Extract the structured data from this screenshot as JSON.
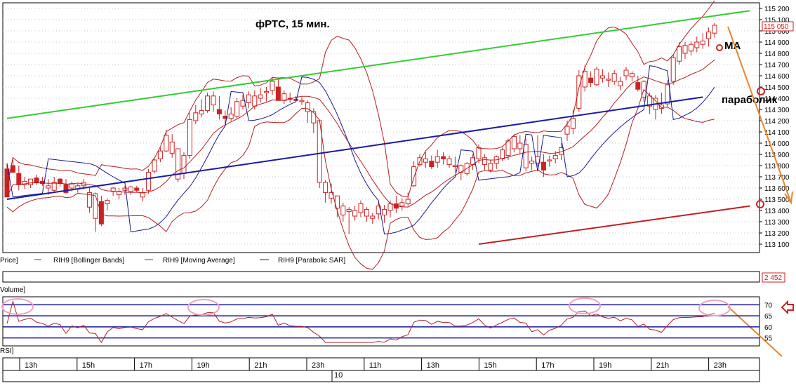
{
  "title": "фРТС,  15 мин.",
  "colors": {
    "up_candle": "#cc2222",
    "down_candle": "#cc2222",
    "bollinger": "#b22020",
    "moving_average": "#b22020",
    "parabolic_sar": "#1a1a8c",
    "green_trend": "#33cc33",
    "blue_trend": "#1a1aa0",
    "red_trend": "#c02020",
    "orange_arrow": "#e8882a",
    "rsi_line": "#b22020",
    "rsi_band": "#1a1aa0",
    "ellipse": "#f0a0c8",
    "last_price_box": "#cc2222"
  },
  "price_axis": {
    "ticks": [
      "115 200",
      "115 100",
      "115 000",
      "114 900",
      "114 800",
      "114 700",
      "114 600",
      "114 500",
      "114 400",
      "114 300",
      "114 200",
      "114 100",
      "114 000",
      "113 900",
      "113 800",
      "113 700",
      "113 600",
      "113 500",
      "113 400",
      "113 300",
      "113 200",
      "113 100"
    ],
    "last_price": "115 050"
  },
  "legend": {
    "price": "Price]",
    "bollinger": "RIH9 [Bollinger Bands]",
    "ma": "RIH9 [Moving Average]",
    "sar": "RIH9 [Parabolic SAR]"
  },
  "annotations": {
    "ma": "MA",
    "parabolic": "параболик"
  },
  "volume": {
    "label": "Volume]",
    "value": "2 452"
  },
  "rsi": {
    "label": "RSI]",
    "ticks": [
      "70",
      "65",
      "60",
      "55"
    ],
    "levels": [
      70,
      65,
      60,
      55
    ]
  },
  "time_axis": {
    "hours": [
      "13h",
      "15h",
      "17h",
      "19h",
      "21h",
      "23h",
      "11h",
      "13h",
      "15h",
      "17h",
      "19h",
      "21h",
      "23h"
    ],
    "day": "10"
  },
  "chart_data": {
    "type": "candlestick",
    "title": "фРТС,  15 мин.",
    "instrument": "RIH9",
    "ylim": [
      113050,
      115230
    ],
    "candles": [
      [
        113770,
        113820,
        113520,
        113520
      ],
      [
        113800,
        113860,
        113740,
        113740
      ],
      [
        113730,
        113800,
        113580,
        113630
      ],
      [
        113630,
        113700,
        113590,
        113660
      ],
      [
        113630,
        113680,
        113600,
        113680
      ],
      [
        113690,
        113720,
        113630,
        113650
      ],
      [
        113660,
        113700,
        113620,
        113640
      ],
      [
        113600,
        113680,
        113540,
        113620
      ],
      [
        113580,
        113700,
        113560,
        113650
      ],
      [
        113680,
        113690,
        113610,
        113640
      ],
      [
        113630,
        113680,
        113550,
        113560
      ],
      [
        113600,
        113660,
        113570,
        113640
      ],
      [
        113590,
        113640,
        113560,
        113620
      ],
      [
        113620,
        113680,
        113590,
        113650
      ],
      [
        113430,
        113600,
        113380,
        113560
      ],
      [
        113330,
        113560,
        113210,
        113550
      ],
      [
        113480,
        113530,
        113260,
        113280
      ],
      [
        113460,
        113510,
        113400,
        113490
      ],
      [
        113570,
        113610,
        113530,
        113600
      ],
      [
        113540,
        113600,
        113500,
        113570
      ],
      [
        113580,
        113620,
        113540,
        113600
      ],
      [
        113570,
        113620,
        113540,
        113610
      ],
      [
        113600,
        113620,
        113560,
        113580
      ],
      [
        113520,
        113600,
        113480,
        113560
      ],
      [
        113580,
        113770,
        113550,
        113740
      ],
      [
        113750,
        113860,
        113730,
        113850
      ],
      [
        113860,
        113960,
        113830,
        113930
      ],
      [
        113930,
        114120,
        113920,
        114070
      ],
      [
        113910,
        114080,
        113870,
        114010
      ],
      [
        113680,
        113950,
        113650,
        113950
      ],
      [
        113730,
        113920,
        113680,
        113890
      ],
      [
        113890,
        114270,
        113860,
        114210
      ],
      [
        114200,
        114340,
        114170,
        114270
      ],
      [
        114260,
        114390,
        114230,
        114290
      ],
      [
        114290,
        114450,
        114270,
        114420
      ],
      [
        114340,
        114460,
        114280,
        114420
      ],
      [
        114300,
        114420,
        114210,
        114260
      ],
      [
        114240,
        114290,
        114170,
        114220
      ],
      [
        114220,
        114320,
        114200,
        114260
      ],
      [
        114240,
        114400,
        114220,
        114370
      ],
      [
        114330,
        114430,
        114300,
        114380
      ],
      [
        114360,
        114460,
        114310,
        114430
      ],
      [
        114330,
        114470,
        114300,
        114420
      ],
      [
        114400,
        114490,
        114360,
        114430
      ],
      [
        114450,
        114500,
        114370,
        114460
      ],
      [
        114470,
        114590,
        114430,
        114550
      ],
      [
        114500,
        114570,
        114380,
        114380
      ],
      [
        114380,
        114470,
        114350,
        114440
      ],
      [
        114400,
        114450,
        114360,
        114390
      ],
      [
        114390,
        114420,
        114370,
        114380
      ],
      [
        114370,
        114410,
        114340,
        114380
      ],
      [
        114280,
        114380,
        114180,
        114360
      ],
      [
        114180,
        114310,
        114090,
        114280
      ],
      [
        113650,
        114210,
        113600,
        114200
      ],
      [
        113560,
        113670,
        113470,
        113650
      ],
      [
        113510,
        113640,
        113460,
        113560
      ],
      [
        113420,
        113530,
        113340,
        113530
      ],
      [
        113360,
        113470,
        113300,
        113440
      ],
      [
        113390,
        113430,
        113190,
        113410
      ],
      [
        113350,
        113440,
        113310,
        113400
      ],
      [
        113380,
        113490,
        113340,
        113460
      ],
      [
        113350,
        113430,
        113300,
        113410
      ],
      [
        113330,
        113380,
        113280,
        113350
      ],
      [
        113370,
        113480,
        113320,
        113440
      ],
      [
        113360,
        113450,
        113290,
        113410
      ],
      [
        113400,
        113490,
        113340,
        113460
      ],
      [
        113460,
        113530,
        113380,
        113420
      ],
      [
        113440,
        113510,
        113400,
        113470
      ],
      [
        113460,
        113560,
        113440,
        113500
      ],
      [
        113620,
        113840,
        113610,
        113790
      ],
      [
        113810,
        113900,
        113790,
        113870
      ],
      [
        113830,
        113920,
        113780,
        113860
      ],
      [
        113840,
        113890,
        113770,
        113790
      ],
      [
        113830,
        113940,
        113780,
        113880
      ],
      [
        113880,
        113920,
        113810,
        113860
      ],
      [
        113810,
        113890,
        113780,
        113860
      ],
      [
        113800,
        113880,
        113740,
        113800
      ],
      [
        113740,
        113810,
        113670,
        113800
      ],
      [
        113730,
        113830,
        113710,
        113820
      ],
      [
        113810,
        113900,
        113760,
        113870
      ],
      [
        113860,
        113990,
        113820,
        113960
      ],
      [
        113810,
        113900,
        113760,
        113870
      ],
      [
        113760,
        113850,
        113740,
        113820
      ],
      [
        113820,
        113890,
        113770,
        113880
      ],
      [
        113860,
        113960,
        113840,
        113940
      ],
      [
        113890,
        114040,
        113850,
        114020
      ],
      [
        113950,
        114080,
        113920,
        114060
      ],
      [
        113950,
        114070,
        113900,
        114000
      ],
      [
        113780,
        114040,
        113750,
        113990
      ],
      [
        113820,
        113880,
        113760,
        113840
      ],
      [
        113820,
        114070,
        113790,
        113880
      ],
      [
        113830,
        113900,
        113700,
        113760
      ],
      [
        113850,
        113890,
        113790,
        113850
      ],
      [
        113860,
        113930,
        113820,
        113890
      ],
      [
        113900,
        114000,
        113850,
        113960
      ],
      [
        114080,
        114200,
        114020,
        114150
      ],
      [
        114130,
        114300,
        114080,
        114220
      ],
      [
        114310,
        114650,
        114280,
        114600
      ],
      [
        114500,
        114690,
        114460,
        114640
      ],
      [
        114580,
        114640,
        114500,
        114540
      ],
      [
        114520,
        114680,
        114510,
        114660
      ],
      [
        114580,
        114660,
        114540,
        114600
      ],
      [
        114570,
        114630,
        114500,
        114570
      ],
      [
        114550,
        114650,
        114520,
        114620
      ],
      [
        114510,
        114590,
        114470,
        114550
      ],
      [
        114600,
        114680,
        114560,
        114650
      ],
      [
        114590,
        114640,
        114550,
        114620
      ],
      [
        114540,
        114600,
        114460,
        114480
      ],
      [
        114410,
        114560,
        114370,
        114550
      ],
      [
        114330,
        114450,
        114260,
        114420
      ],
      [
        114300,
        114430,
        114210,
        114400
      ],
      [
        114310,
        114450,
        114260,
        114340
      ],
      [
        114350,
        114560,
        114320,
        114520
      ],
      [
        114550,
        114790,
        114520,
        114760
      ],
      [
        114730,
        114900,
        114700,
        114860
      ],
      [
        114800,
        114900,
        114750,
        114870
      ],
      [
        114820,
        114910,
        114780,
        114880
      ],
      [
        114850,
        114950,
        114810,
        114900
      ],
      [
        114880,
        114980,
        114840,
        114910
      ],
      [
        114930,
        115030,
        114860,
        114990
      ],
      [
        114980,
        115070,
        114940,
        115050
      ]
    ],
    "trendlines": [
      {
        "color": "green",
        "from": [
          0,
          114220
        ],
        "to": [
          126,
          115180
        ]
      },
      {
        "color": "blue",
        "from": [
          0,
          113500
        ],
        "to": [
          118,
          114410
        ]
      },
      {
        "color": "red",
        "from": [
          80,
          113100
        ],
        "to": [
          126,
          113440
        ]
      }
    ],
    "rsi_levels": [
      70,
      65,
      60,
      55
    ]
  }
}
